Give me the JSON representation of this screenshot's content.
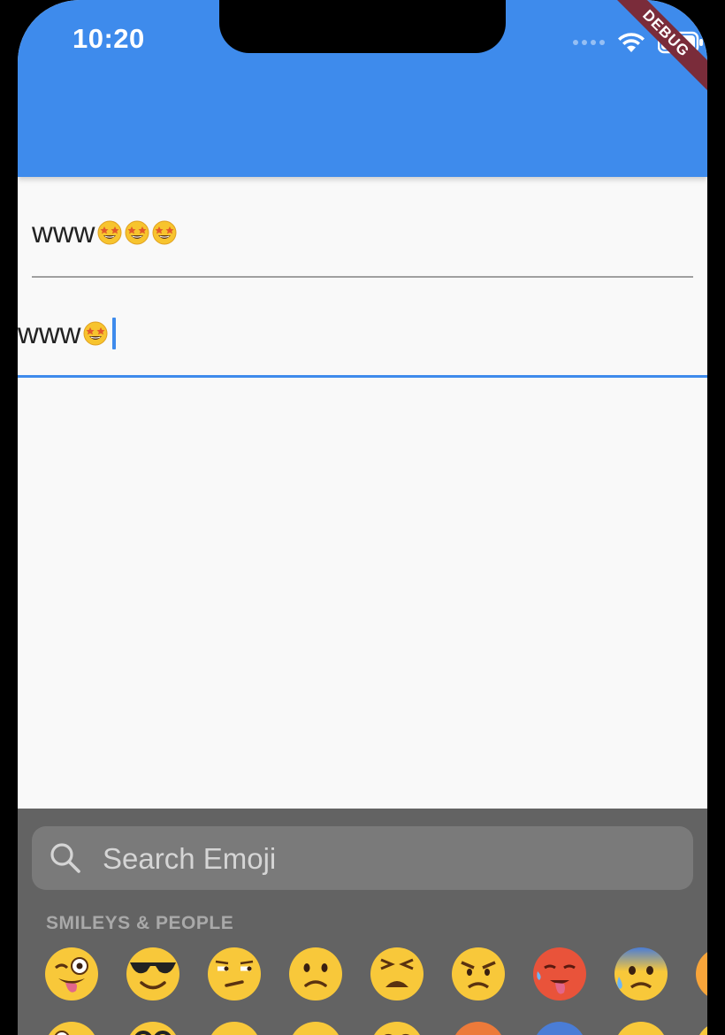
{
  "status_bar": {
    "time": "10:20",
    "debug_label": "DEBUG"
  },
  "field_one": {
    "text": "www",
    "emoji": [
      "star-struck",
      "star-struck",
      "star-struck"
    ]
  },
  "field_two": {
    "text": "www",
    "emoji": [
      "star-struck"
    ]
  },
  "keyboard": {
    "search_placeholder": "Search Emoji",
    "category_label": "SMILEYS & PEOPLE",
    "row1": [
      "winking-tongue",
      "sunglasses",
      "unamused",
      "slightly-frowning",
      "weary",
      "angry",
      "hot-face",
      "anxious-sweat",
      "partial"
    ],
    "row2": [
      "zany",
      "nerd",
      "neutral",
      "expressionless",
      "worried",
      "pouting",
      "cold-face",
      "sweat",
      "partial"
    ]
  },
  "colors": {
    "accent": "#3e8bec",
    "keyboard_bg": "#636363",
    "search_bg": "#7a7a7a",
    "ribbon": "#7a2c3a"
  }
}
